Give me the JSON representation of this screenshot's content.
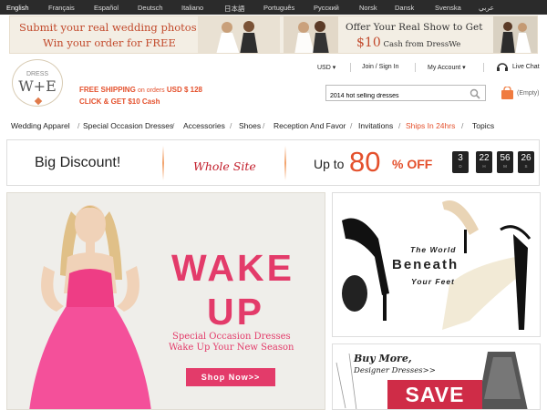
{
  "languages": [
    "English",
    "Français",
    "Español",
    "Deutsch",
    "Italiano",
    "日本語",
    "Português",
    "Русский",
    "Norsk",
    "Dansk",
    "Svenska",
    "عربي"
  ],
  "promo": {
    "line1": "Submit your real wedding photos",
    "line2": "Win your order for FREE",
    "right1": "Offer Your Real Show to Get",
    "right2_amount": "$10",
    "right2_text": "Cash from DressWe"
  },
  "logo": {
    "top": "DRESS",
    "main": "W+E"
  },
  "shipping": {
    "label": "FREE SHIPPING",
    "small": "on orders",
    "amount": "USD $  128",
    "line2": "CLICK & GET $10 Cash"
  },
  "topnav": {
    "currency": "USD",
    "signin": "Join / Sign In",
    "account": "My Account",
    "chat": "Live Chat"
  },
  "search": {
    "value": "2014 hot selling dresses"
  },
  "cart": {
    "label": "(Empty)"
  },
  "mainnav": [
    "Wedding Apparel",
    "Special Occasion Dresses",
    "Accessories",
    "Shoes",
    "Reception And Favor",
    "Invitations",
    "Ships In 24hrs",
    "Topics"
  ],
  "discount": {
    "big": "Big Discount!",
    "site": "Whole Site",
    "upto": "Up to",
    "pct": "80",
    "off": "% OFF",
    "timer": [
      {
        "num": "3",
        "lbl": "D"
      },
      {
        "num": "22",
        "lbl": "H"
      },
      {
        "num": "56",
        "lbl": "M"
      },
      {
        "num": "26",
        "lbl": "S"
      }
    ]
  },
  "hero": {
    "wake": "WAKE",
    "up": "UP",
    "sub1": "Special Occasion Dresses",
    "sub2": "Wake Up Your New Season",
    "button": "Shop Now>>"
  },
  "shoes": {
    "l1": "The World",
    "l2": "Beneath",
    "l3": "Your Feet"
  },
  "save": {
    "l1": "Buy More,",
    "l2": "Designer Dresses>>",
    "l3": "SAVE"
  },
  "colors": {
    "accent": "#e4502c",
    "hero_pink": "#e33b6a",
    "lang_bar": "#2b2b2b"
  }
}
